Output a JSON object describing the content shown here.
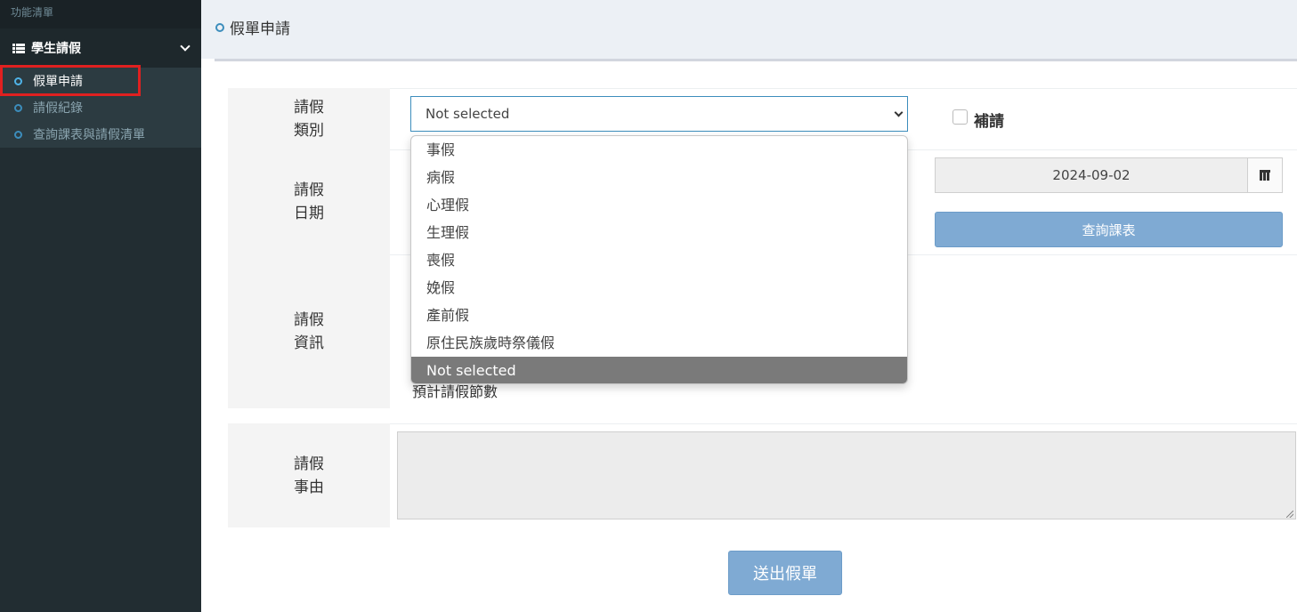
{
  "sidebar": {
    "header": "功能清單",
    "group": {
      "label": "學生請假",
      "icon": "list-icon"
    },
    "items": [
      {
        "label": "假單申請",
        "active": true
      },
      {
        "label": "請假紀錄",
        "active": false
      },
      {
        "label": "查詢課表與請假清單",
        "active": false
      }
    ]
  },
  "page": {
    "title": "假單申請"
  },
  "form": {
    "leave_type": {
      "label_line1": "請假",
      "label_line2": "類別",
      "selected": "Not selected"
    },
    "supplement": {
      "label": "補請",
      "checked": false
    },
    "leave_date": {
      "label_line1": "請假",
      "label_line2": "日期",
      "value": "2024-09-02"
    },
    "query_button": "查詢課表",
    "leave_info": {
      "label_line1": "請假",
      "label_line2": "資訊",
      "count_label": "預計請假節數"
    },
    "reason": {
      "label_line1": "請假",
      "label_line2": "事由",
      "value": ""
    },
    "submit_button": "送出假單"
  },
  "dropdown": {
    "options": [
      "事假",
      "病假",
      "心理假",
      "生理假",
      "喪假",
      "娩假",
      "產前假",
      "原住民族歲時祭儀假",
      "Not selected"
    ],
    "highlighted": "Not selected"
  },
  "colors": {
    "accent": "#3c8dbc",
    "sidebar_bg": "#222d32",
    "button": "#7faad3",
    "active_frame": "#e02020"
  }
}
